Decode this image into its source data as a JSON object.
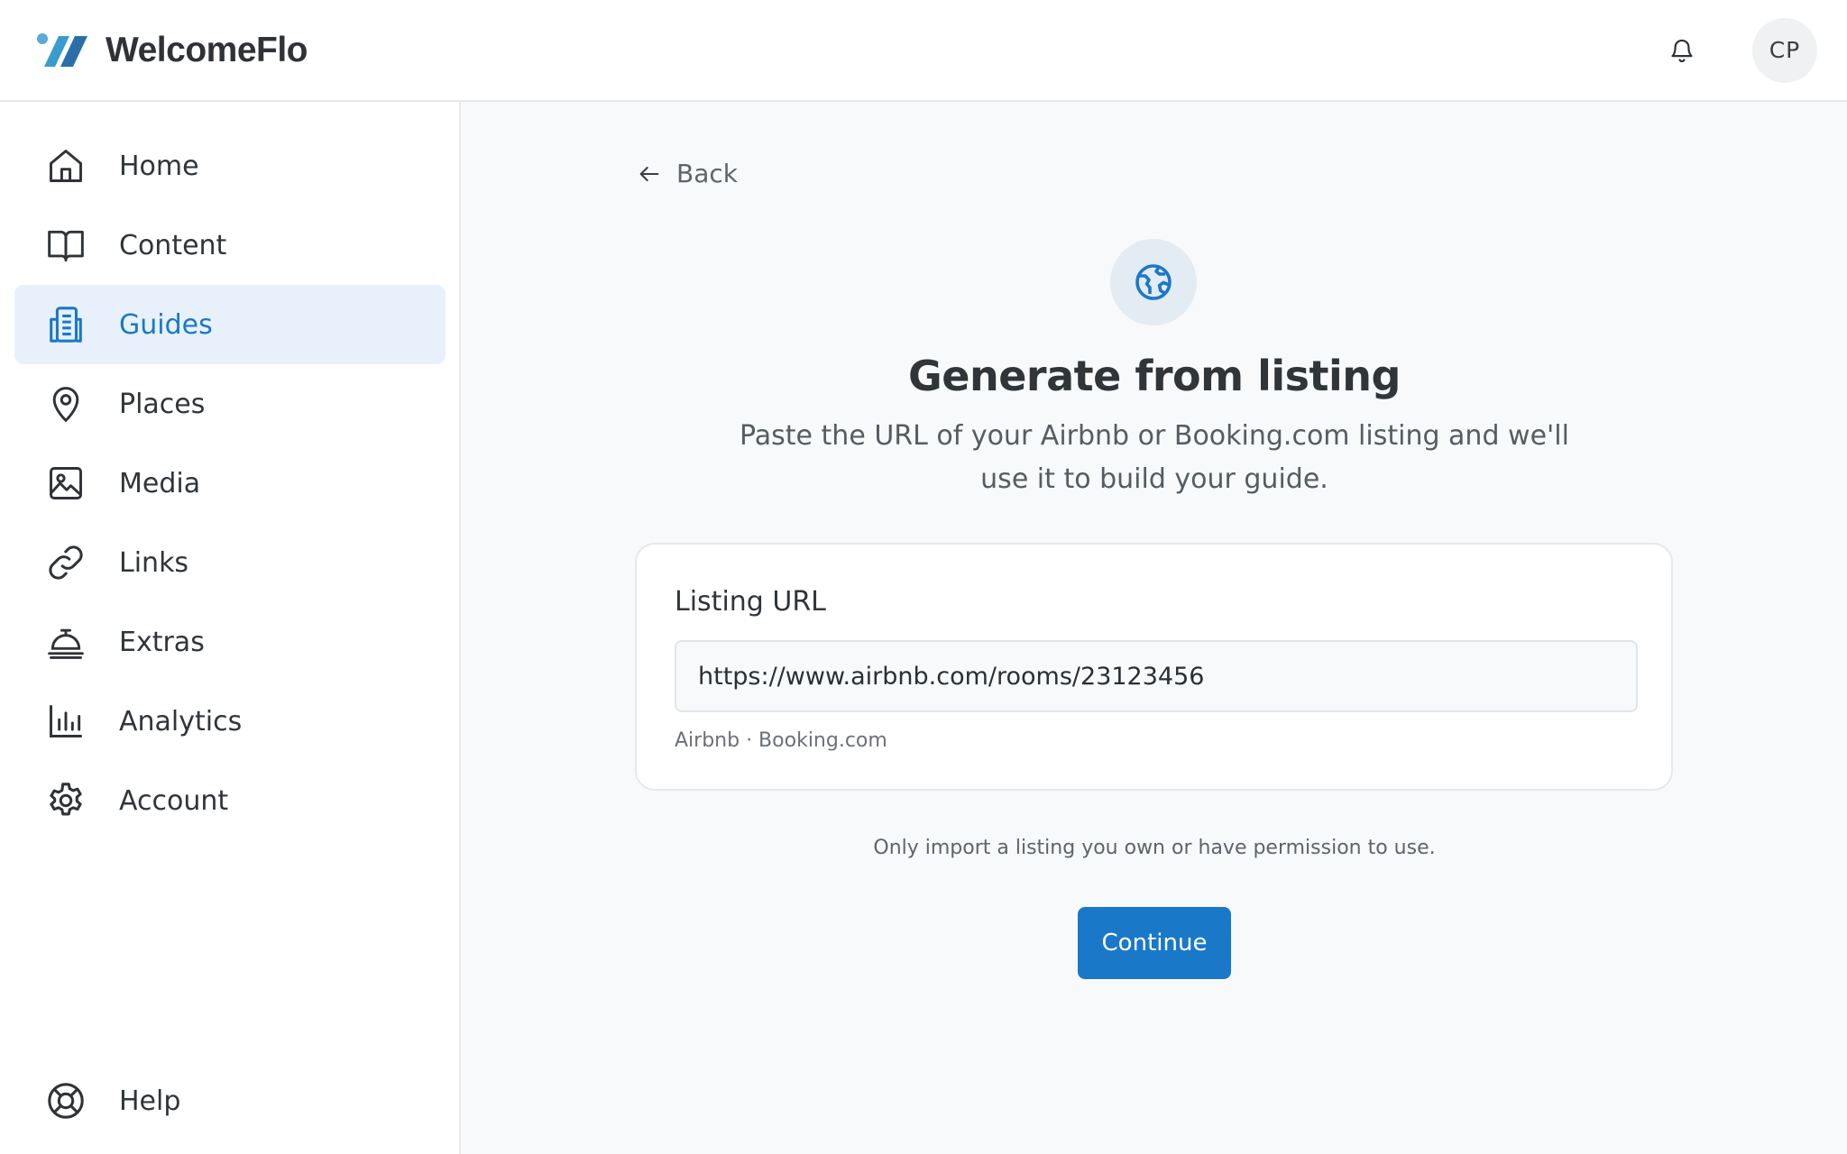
{
  "app": {
    "name": "WelcomeFlo"
  },
  "header": {
    "avatar_initials": "CP",
    "bell_icon": "bell-icon"
  },
  "sidebar": {
    "items": [
      {
        "label": "Home",
        "icon": "home-icon"
      },
      {
        "label": "Content",
        "icon": "book-open-icon"
      },
      {
        "label": "Guides",
        "icon": "guides-icon",
        "active": true
      },
      {
        "label": "Places",
        "icon": "map-pin-icon"
      },
      {
        "label": "Media",
        "icon": "image-icon"
      },
      {
        "label": "Links",
        "icon": "link-icon"
      },
      {
        "label": "Extras",
        "icon": "concierge-bell-icon"
      },
      {
        "label": "Analytics",
        "icon": "bar-chart-icon"
      },
      {
        "label": "Account",
        "icon": "gear-icon"
      }
    ],
    "help": {
      "label": "Help",
      "icon": "lifebuoy-icon"
    }
  },
  "main": {
    "back_label": "Back",
    "hero_icon": "globe-icon",
    "title": "Generate from listing",
    "subtitle": "Paste the URL of your Airbnb or Booking.com listing and we'll use it to build your guide.",
    "field": {
      "label": "Listing URL",
      "value": "https://www.airbnb.com/rooms/23123456",
      "hint": "Airbnb · Booking.com"
    },
    "disclaimer": "Only import a listing you own or have permission to use.",
    "continue_label": "Continue"
  },
  "colors": {
    "accent": "#1a78c9",
    "active_bg": "#e8f1fb",
    "page_bg": "#f8f9fa",
    "text": "#30353a"
  }
}
